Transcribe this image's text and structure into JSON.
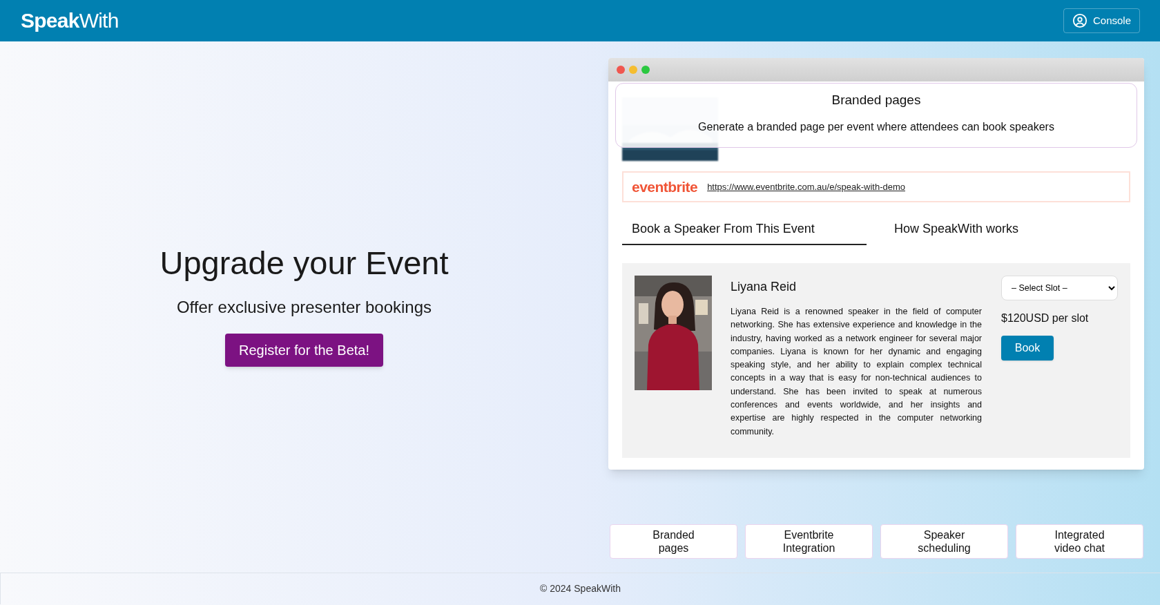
{
  "header": {
    "logo_bold": "Speak",
    "logo_light": "With",
    "console_button": "Console"
  },
  "hero": {
    "title": "Upgrade your Event",
    "subtitle": "Offer exclusive presenter bookings",
    "cta": "Register for the Beta!"
  },
  "demo": {
    "overlay": {
      "title": "Branded pages",
      "description": "Generate a branded page per event where attendees can book speakers"
    },
    "eventbrite": {
      "logo": "eventbrite",
      "url": "https://www.eventbrite.com.au/e/speak-with-demo"
    },
    "tabs": [
      {
        "label": "Book a Speaker From This Event",
        "selected": true
      },
      {
        "label": "How SpeakWith works",
        "selected": false
      }
    ],
    "speaker": {
      "name": "Liyana Reid",
      "bio": "Liyana Reid is a renowned speaker in the field of computer networking. She has extensive experience and knowledge in the industry, having worked as a network engineer for several major companies. Liyana is known for her dynamic and engaging speaking style, and her ability to explain complex technical concepts in a way that is easy for non-technical audiences to understand. She has been invited to speak at numerous conferences and events worldwide, and her insights and expertise are highly respected in the computer networking community.",
      "slot_select": "– Select Slot –",
      "price": "$120USD per slot",
      "book_button": "Book"
    }
  },
  "features": [
    "Branded pages",
    "Eventbrite Integration",
    "Speaker scheduling",
    "Integrated video chat"
  ],
  "footer": "© 2024 SpeakWith"
}
